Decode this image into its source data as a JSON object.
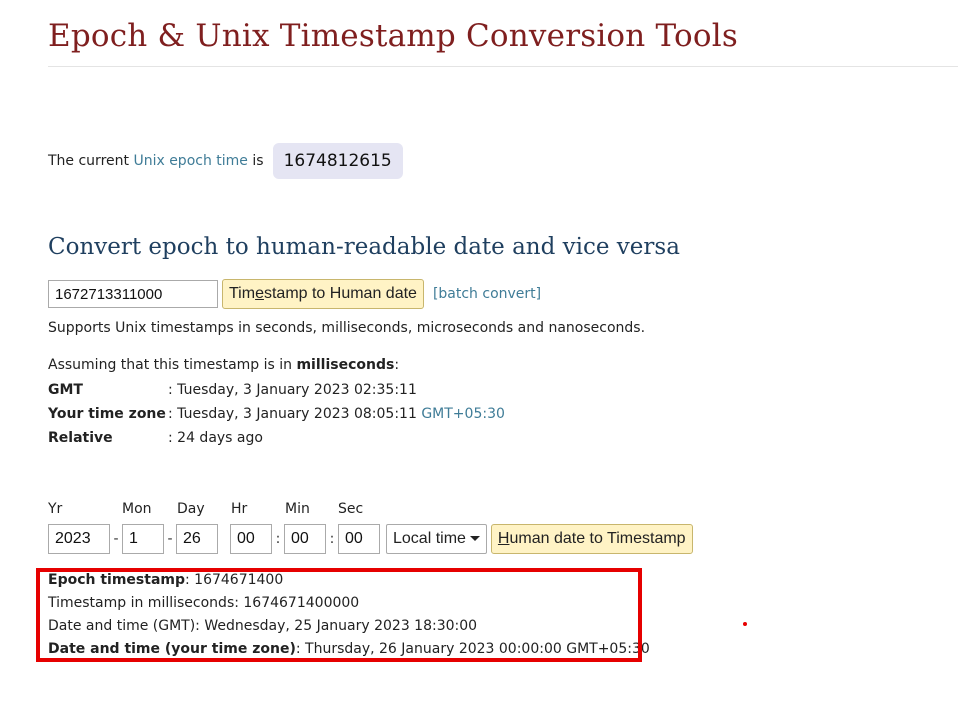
{
  "header": {
    "title": "Epoch & Unix Timestamp Conversion Tools"
  },
  "current": {
    "prefix": "The current",
    "link": "Unix epoch time",
    "suffix": "is",
    "value": "1674812615"
  },
  "convert": {
    "heading": "Convert epoch to human-readable date and vice versa",
    "input_value": "1672713311000",
    "button_pre": "Tim",
    "button_u": "e",
    "button_post": "stamp to Human date",
    "batch_link": "[batch convert]",
    "supports": "Supports Unix timestamps in seconds, milliseconds, microseconds and nanoseconds."
  },
  "result": {
    "assume_prefix": "Assuming that this timestamp is in",
    "assume_unit": "milliseconds",
    "assume_suffix": ":",
    "rows": [
      {
        "key": "GMT",
        "value": ": Tuesday, 3 January 2023 02:35:11",
        "suffix": ""
      },
      {
        "key": "Your time zone",
        "value": ": Tuesday, 3 January 2023 08:05:11",
        "suffix": "GMT+05:30"
      },
      {
        "key": "Relative",
        "value": ": 24 days ago",
        "suffix": ""
      }
    ]
  },
  "date_form": {
    "labels": {
      "yr": "Yr",
      "mon": "Mon",
      "day": "Day",
      "hr": "Hr",
      "min": "Min",
      "sec": "Sec"
    },
    "values": {
      "yr": "2023",
      "mon": "1",
      "day": "26",
      "hr": "00",
      "min": "00",
      "sec": "00"
    },
    "sep_date": "-",
    "sep_time": ":",
    "timezone": "Local time",
    "button_u": "H",
    "button_rest": "uman date to Timestamp"
  },
  "output": {
    "epoch_label": "Epoch timestamp",
    "epoch_value": ": 1674671400",
    "ms_line": "Timestamp in milliseconds: 1674671400000",
    "gmt_line": "Date and time (GMT): Wednesday, 25 January 2023 18:30:00",
    "local_label": "Date and time (your time zone)",
    "local_value": ": Thursday, 26 January 2023 00:00:00 GMT+05:30"
  },
  "colors": {
    "title": "#7f1f1f",
    "section_title": "#1f3f5f",
    "link": "#3f7c97",
    "button_bg": "#fff3c5",
    "badge_bg": "#e5e5f3",
    "highlight": "#e60000"
  }
}
